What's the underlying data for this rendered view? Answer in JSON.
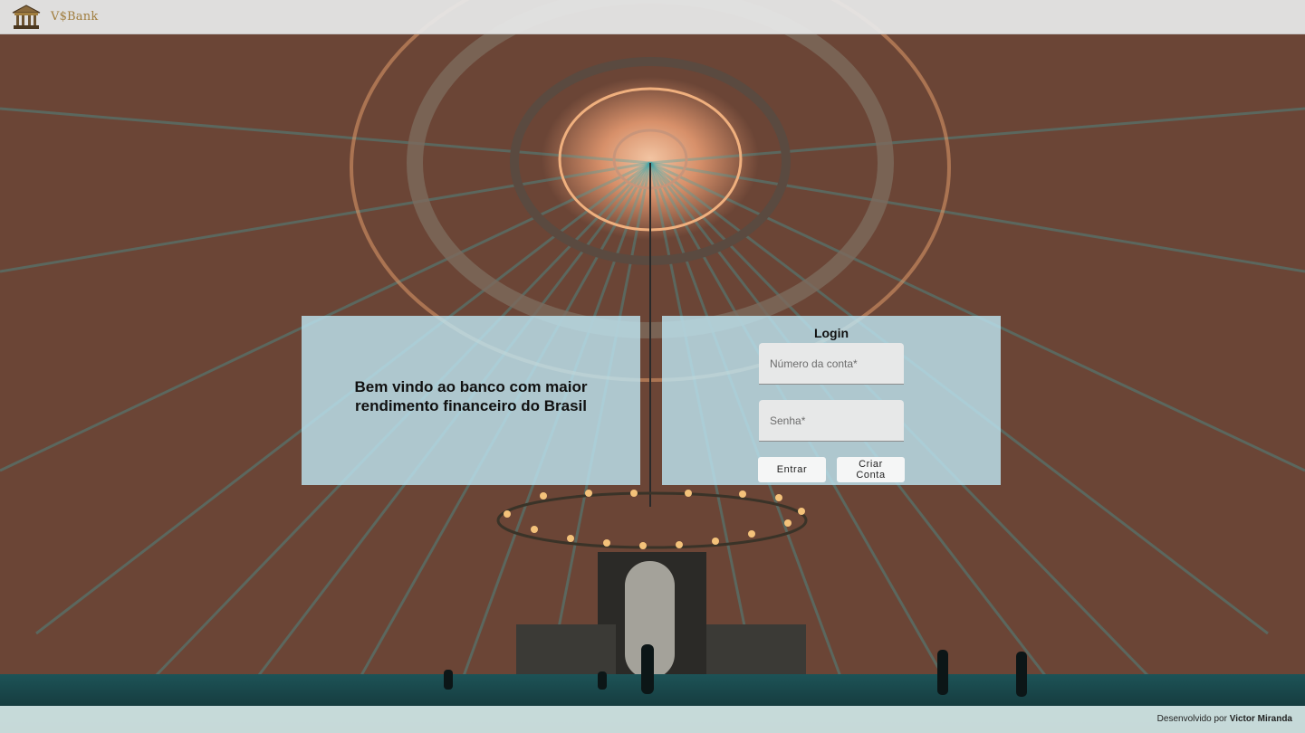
{
  "header": {
    "brand": "V$Bank",
    "logo_icon": "bank-building-icon"
  },
  "welcome": {
    "message": "Bem vindo ao banco com maior rendimento financeiro do Brasil"
  },
  "login": {
    "title": "Login",
    "account_placeholder": "Número da conta*",
    "password_placeholder": "Senha*",
    "enter_label": "Entrar",
    "create_label": "Criar Conta"
  },
  "footer": {
    "prefix": "Desenvolvido por",
    "author": "Victor Miranda"
  },
  "colors": {
    "brand_gold": "#a07d3e",
    "card_bg": "#bde4f0",
    "header_bg": "#e8eae9"
  }
}
